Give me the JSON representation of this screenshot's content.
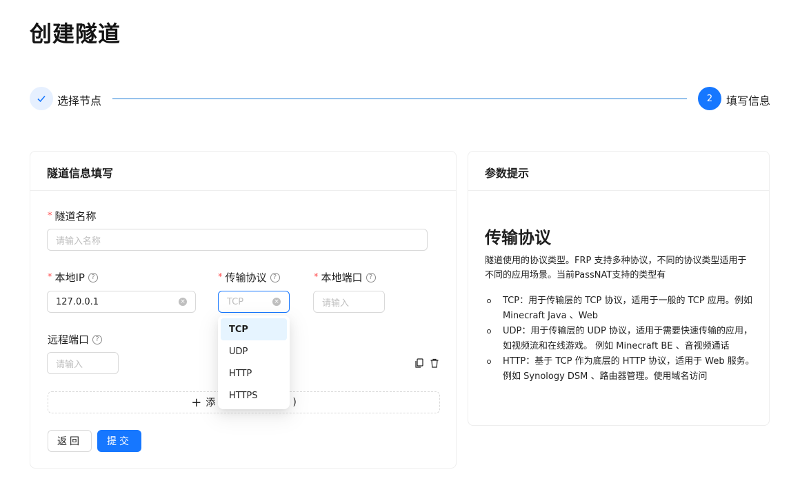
{
  "page": {
    "title": "创建隧道"
  },
  "steps": [
    {
      "label": "选择节点",
      "status": "done",
      "icon": "check-icon"
    },
    {
      "label": "填写信息",
      "status": "current",
      "number": "2"
    }
  ],
  "form_card": {
    "title": "隧道信息填写",
    "name_field": {
      "label": "隧道名称",
      "required": "*",
      "placeholder": "请输入名称",
      "value": ""
    },
    "local_ip": {
      "label": "本地IP",
      "required": "*",
      "value": "127.0.0.1",
      "help": "?"
    },
    "protocol": {
      "label": "传输协议",
      "required": "*",
      "placeholder": "TCP",
      "help": "?",
      "options": [
        "TCP",
        "UDP",
        "HTTP",
        "HTTPS"
      ],
      "selected": "TCP"
    },
    "local_port": {
      "label": "本地端口",
      "required": "*",
      "placeholder": "请输入",
      "help": "?"
    },
    "remote_port": {
      "label": "远程端口",
      "placeholder": "请输入",
      "help": "?"
    },
    "add_button": {
      "label_start": "添",
      "label_end": ")"
    },
    "back_button": "返回",
    "submit_button": "提交",
    "clear_glyph": "×"
  },
  "help_card": {
    "title": "参数提示",
    "heading": "传输协议",
    "intro": "隧道使用的协议类型。FRP 支持多种协议，不同的协议类型适用于不同的应用场景。当前PassNAT支持的类型有",
    "items": [
      "TCP：用于传输层的 TCP 协议，适用于一般的 TCP 应用。例如 Minecraft Java 、Web",
      "UDP：用于传输层的 UDP 协议，适用于需要快速传输的应用，如视频流和在线游戏。 例如 Minecraft BE 、音视频通话",
      "HTTP：基于 TCP 作为底层的 HTTP 协议，适用于 Web 服务。例如 Synology DSM 、路由器管理。使用域名访问"
    ]
  },
  "colors": {
    "primary": "#1677ff",
    "required": "#ff4d4f",
    "border": "#d9d9d9",
    "selected_bg": "#e6f4ff"
  }
}
